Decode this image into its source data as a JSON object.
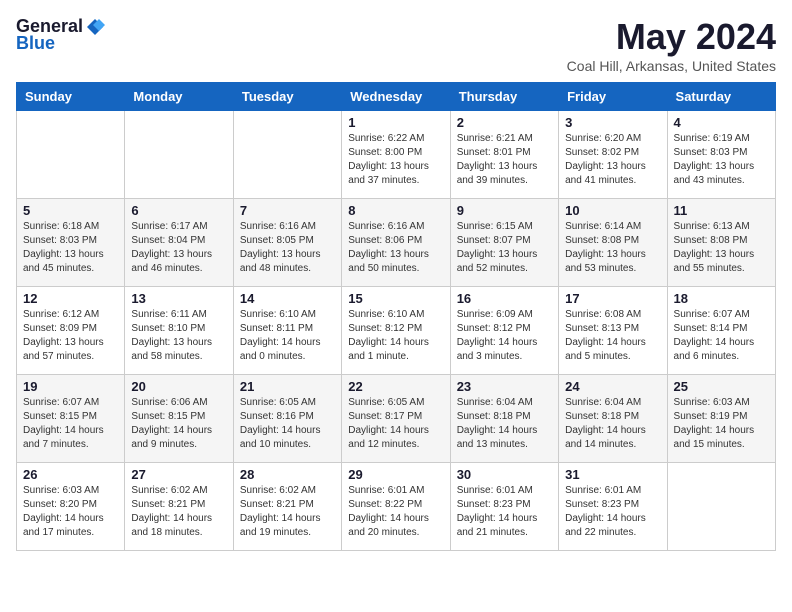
{
  "app": {
    "logo_general": "General",
    "logo_blue": "Blue"
  },
  "header": {
    "month": "May 2024",
    "location": "Coal Hill, Arkansas, United States"
  },
  "weekdays": [
    "Sunday",
    "Monday",
    "Tuesday",
    "Wednesday",
    "Thursday",
    "Friday",
    "Saturday"
  ],
  "weeks": [
    [
      {
        "day": "",
        "info": ""
      },
      {
        "day": "",
        "info": ""
      },
      {
        "day": "",
        "info": ""
      },
      {
        "day": "1",
        "info": "Sunrise: 6:22 AM\nSunset: 8:00 PM\nDaylight: 13 hours\nand 37 minutes."
      },
      {
        "day": "2",
        "info": "Sunrise: 6:21 AM\nSunset: 8:01 PM\nDaylight: 13 hours\nand 39 minutes."
      },
      {
        "day": "3",
        "info": "Sunrise: 6:20 AM\nSunset: 8:02 PM\nDaylight: 13 hours\nand 41 minutes."
      },
      {
        "day": "4",
        "info": "Sunrise: 6:19 AM\nSunset: 8:03 PM\nDaylight: 13 hours\nand 43 minutes."
      }
    ],
    [
      {
        "day": "5",
        "info": "Sunrise: 6:18 AM\nSunset: 8:03 PM\nDaylight: 13 hours\nand 45 minutes."
      },
      {
        "day": "6",
        "info": "Sunrise: 6:17 AM\nSunset: 8:04 PM\nDaylight: 13 hours\nand 46 minutes."
      },
      {
        "day": "7",
        "info": "Sunrise: 6:16 AM\nSunset: 8:05 PM\nDaylight: 13 hours\nand 48 minutes."
      },
      {
        "day": "8",
        "info": "Sunrise: 6:16 AM\nSunset: 8:06 PM\nDaylight: 13 hours\nand 50 minutes."
      },
      {
        "day": "9",
        "info": "Sunrise: 6:15 AM\nSunset: 8:07 PM\nDaylight: 13 hours\nand 52 minutes."
      },
      {
        "day": "10",
        "info": "Sunrise: 6:14 AM\nSunset: 8:08 PM\nDaylight: 13 hours\nand 53 minutes."
      },
      {
        "day": "11",
        "info": "Sunrise: 6:13 AM\nSunset: 8:08 PM\nDaylight: 13 hours\nand 55 minutes."
      }
    ],
    [
      {
        "day": "12",
        "info": "Sunrise: 6:12 AM\nSunset: 8:09 PM\nDaylight: 13 hours\nand 57 minutes."
      },
      {
        "day": "13",
        "info": "Sunrise: 6:11 AM\nSunset: 8:10 PM\nDaylight: 13 hours\nand 58 minutes."
      },
      {
        "day": "14",
        "info": "Sunrise: 6:10 AM\nSunset: 8:11 PM\nDaylight: 14 hours\nand 0 minutes."
      },
      {
        "day": "15",
        "info": "Sunrise: 6:10 AM\nSunset: 8:12 PM\nDaylight: 14 hours\nand 1 minute."
      },
      {
        "day": "16",
        "info": "Sunrise: 6:09 AM\nSunset: 8:12 PM\nDaylight: 14 hours\nand 3 minutes."
      },
      {
        "day": "17",
        "info": "Sunrise: 6:08 AM\nSunset: 8:13 PM\nDaylight: 14 hours\nand 5 minutes."
      },
      {
        "day": "18",
        "info": "Sunrise: 6:07 AM\nSunset: 8:14 PM\nDaylight: 14 hours\nand 6 minutes."
      }
    ],
    [
      {
        "day": "19",
        "info": "Sunrise: 6:07 AM\nSunset: 8:15 PM\nDaylight: 14 hours\nand 7 minutes."
      },
      {
        "day": "20",
        "info": "Sunrise: 6:06 AM\nSunset: 8:15 PM\nDaylight: 14 hours\nand 9 minutes."
      },
      {
        "day": "21",
        "info": "Sunrise: 6:05 AM\nSunset: 8:16 PM\nDaylight: 14 hours\nand 10 minutes."
      },
      {
        "day": "22",
        "info": "Sunrise: 6:05 AM\nSunset: 8:17 PM\nDaylight: 14 hours\nand 12 minutes."
      },
      {
        "day": "23",
        "info": "Sunrise: 6:04 AM\nSunset: 8:18 PM\nDaylight: 14 hours\nand 13 minutes."
      },
      {
        "day": "24",
        "info": "Sunrise: 6:04 AM\nSunset: 8:18 PM\nDaylight: 14 hours\nand 14 minutes."
      },
      {
        "day": "25",
        "info": "Sunrise: 6:03 AM\nSunset: 8:19 PM\nDaylight: 14 hours\nand 15 minutes."
      }
    ],
    [
      {
        "day": "26",
        "info": "Sunrise: 6:03 AM\nSunset: 8:20 PM\nDaylight: 14 hours\nand 17 minutes."
      },
      {
        "day": "27",
        "info": "Sunrise: 6:02 AM\nSunset: 8:21 PM\nDaylight: 14 hours\nand 18 minutes."
      },
      {
        "day": "28",
        "info": "Sunrise: 6:02 AM\nSunset: 8:21 PM\nDaylight: 14 hours\nand 19 minutes."
      },
      {
        "day": "29",
        "info": "Sunrise: 6:01 AM\nSunset: 8:22 PM\nDaylight: 14 hours\nand 20 minutes."
      },
      {
        "day": "30",
        "info": "Sunrise: 6:01 AM\nSunset: 8:23 PM\nDaylight: 14 hours\nand 21 minutes."
      },
      {
        "day": "31",
        "info": "Sunrise: 6:01 AM\nSunset: 8:23 PM\nDaylight: 14 hours\nand 22 minutes."
      },
      {
        "day": "",
        "info": ""
      }
    ]
  ]
}
